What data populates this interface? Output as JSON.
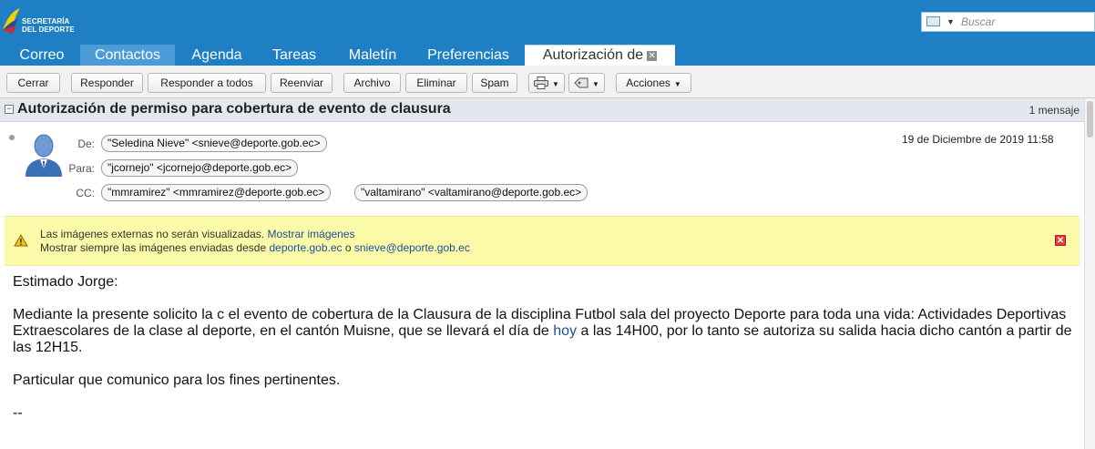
{
  "header": {
    "logo_line1": "SECRETARÍA",
    "logo_line2": "DEL DEPORTE",
    "search_placeholder": "Buscar"
  },
  "tabs": [
    {
      "label": "Correo"
    },
    {
      "label": "Contactos"
    },
    {
      "label": "Agenda"
    },
    {
      "label": "Tareas"
    },
    {
      "label": "Maletín"
    },
    {
      "label": "Preferencias"
    },
    {
      "label": "Autorización de"
    }
  ],
  "toolbar": {
    "close": "Cerrar",
    "reply": "Responder",
    "reply_all": "Responder a todos",
    "forward": "Reenviar",
    "archive": "Archivo",
    "delete": "Eliminar",
    "spam": "Spam",
    "actions": "Acciones"
  },
  "message": {
    "subject": "Autorización de permiso para cobertura de evento de clausura",
    "count": "1 mensaje",
    "from_label": "De:",
    "to_label": "Para:",
    "cc_label": "CC:",
    "from": "\"Seledina Nieve\" <snieve@deporte.gob.ec>",
    "to": "\"jcornejo\" <jcornejo@deporte.gob.ec>",
    "cc": [
      "\"mmramirez\" <mmramirez@deporte.gob.ec>",
      "\"valtamirano\" <valtamirano@deporte.gob.ec>"
    ],
    "date": "19 de Diciembre de 2019 11:58"
  },
  "warning": {
    "line1": "Las imágenes externas no serán visualizadas.",
    "show_images": "Mostrar imágenes",
    "line2": "Mostrar siempre las imágenes enviadas desde",
    "domain_link": "deporte.gob.ec",
    "or": "o",
    "sender_link": "snieve@deporte.gob.ec"
  },
  "body": {
    "greeting": "Estimado Jorge:",
    "para1_a": "Mediante la presente solicito la c el evento de cobertura de la Clausura de la disciplina Futbol sala del proyecto Deporte para toda una vida: Actividades Deportivas Extraescolares de la clase al deporte, en el cantón Muisne, que se llevará el día de",
    "para1_link": "hoy",
    "para1_b": "a las 14H00, por lo tanto se autoriza su salida hacia dicho cantón a partir de las 12H15.",
    "para2": "Particular que comunico para los fines pertinentes.",
    "signature": "--"
  }
}
